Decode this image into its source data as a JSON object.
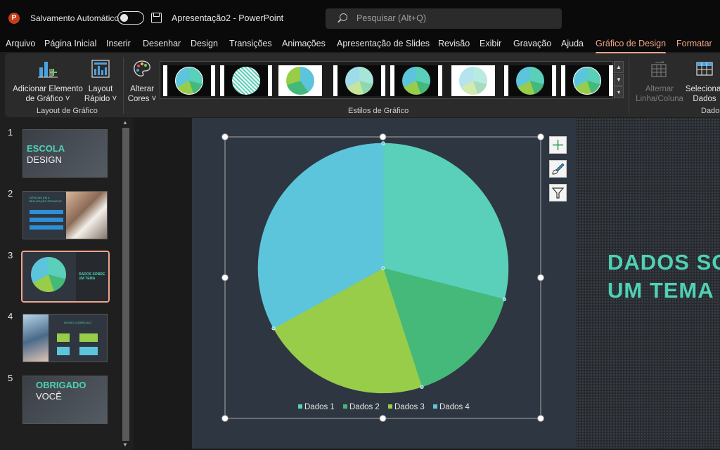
{
  "titlebar": {
    "app_logo": "P",
    "autosave_label": "Salvamento Automático",
    "document_title": "Apresentação2  -  PowerPoint",
    "search_placeholder": "Pesquisar (Alt+Q)"
  },
  "menu_tabs": [
    "Arquivo",
    "Página Inicial",
    "Inserir",
    "Desenhar",
    "Design",
    "Transições",
    "Animações",
    "Apresentação de Slides",
    "Revisão",
    "Exibir",
    "Gravação",
    "Ajuda",
    "Gráfico de Design",
    "Formatar"
  ],
  "active_tab": "Gráfico de Design",
  "ribbon": {
    "add_element_line1": "Adicionar Elemento",
    "add_element_line2": "de Gráfico",
    "quick_layout_line1": "Layout",
    "quick_layout_line2": "Rápido",
    "change_colors_line1": "Alterar",
    "change_colors_line2": "Cores",
    "group_layout": "Layout de Gráfico",
    "group_styles": "Estilos de Gráfico",
    "switch_row_col_line1": "Alternar",
    "switch_row_col_line2": "Linha/Coluna",
    "select_data_line1": "Selecionar",
    "select_data_line2": "Dados",
    "group_data": "Dados"
  },
  "slides": [
    {
      "number": "1",
      "line1": "ESCOLA",
      "line2": "DESIGN"
    },
    {
      "number": "2",
      "line1": "CIÊNCIAS EM A REALIZAÇÃO PROMOVE",
      "line2": ""
    },
    {
      "number": "3",
      "line1": "DADOS SOBRE",
      "line2": "UM TEMA"
    },
    {
      "number": "4",
      "line1": "NOSSO",
      "line2": "CURRÍCULO"
    },
    {
      "number": "5",
      "line1": "OBRIGADO",
      "line2": "VOCÊ"
    }
  ],
  "slide_title_line1": "DADOS SOBRE",
  "slide_title_line2": "UM TEMA",
  "colors": {
    "accent": "#f0a58c",
    "series": [
      "#5acfb9",
      "#45b97a",
      "#98cd4a",
      "#5cc5dc"
    ]
  },
  "chart_data": {
    "type": "pie",
    "categories": [
      "Dados 1",
      "Dados 2",
      "Dados 3",
      "Dados 4"
    ],
    "values": [
      29,
      16,
      22,
      33
    ],
    "legend": "bottom"
  }
}
